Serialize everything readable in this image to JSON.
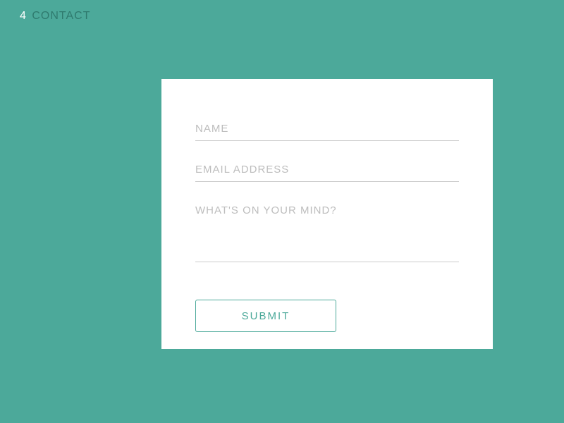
{
  "header": {
    "number": "4",
    "title": "CONTACT"
  },
  "form": {
    "name_placeholder": "NAME",
    "email_placeholder": "EMAIL ADDRESS",
    "message_placeholder": "WHAT'S ON YOUR MIND?",
    "submit_label": "SUBMIT"
  },
  "colors": {
    "background": "#4ca99a",
    "card": "#ffffff",
    "placeholder": "#bdbdbd",
    "accent": "#4ca99a"
  }
}
